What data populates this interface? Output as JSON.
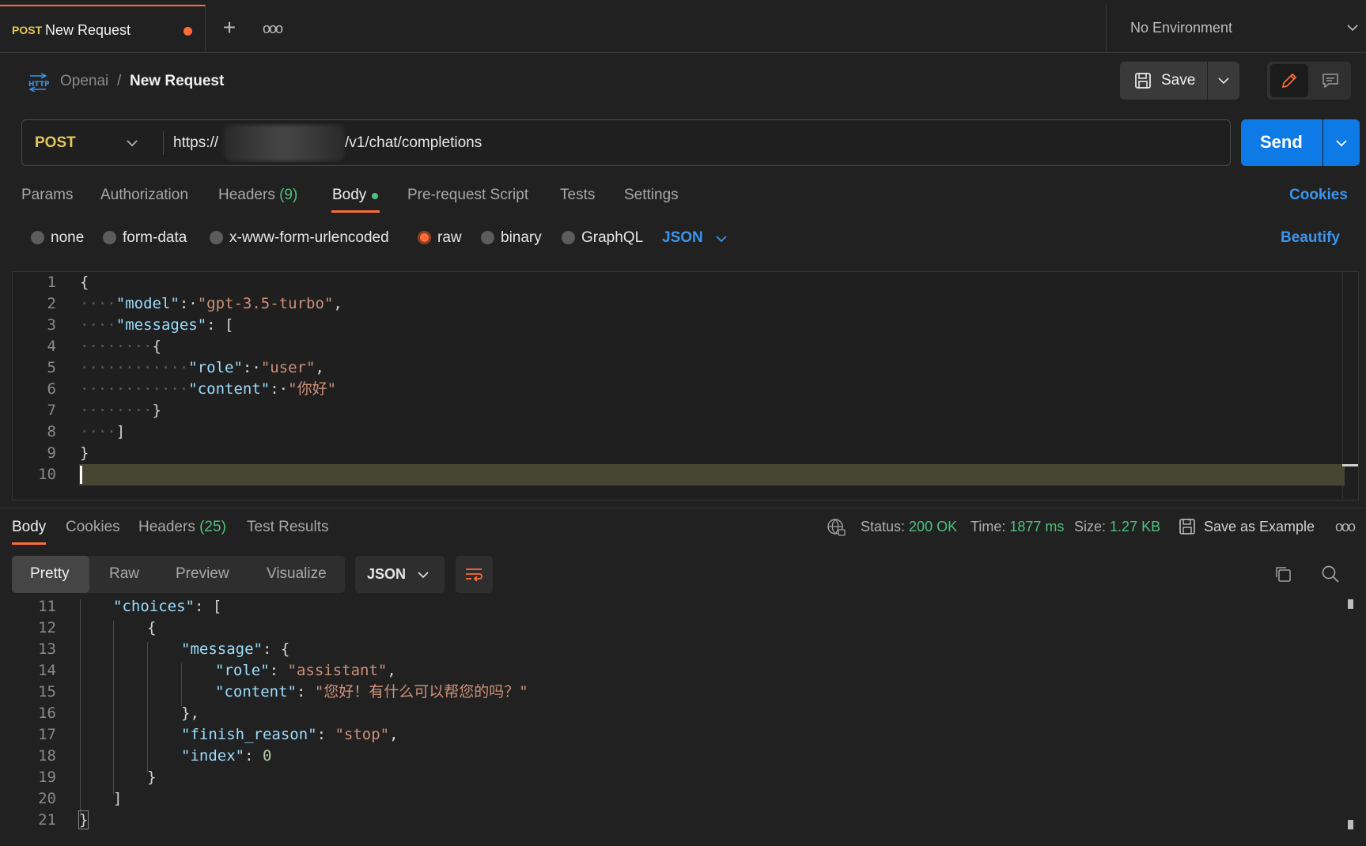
{
  "tabs": {
    "active": {
      "method": "POST",
      "title": "New Request"
    },
    "more": "ooo"
  },
  "environment": {
    "label": "No Environment"
  },
  "breadcrumb": {
    "parent": "Openai",
    "separator": "/",
    "current": "New Request"
  },
  "toolbar": {
    "save_label": "Save"
  },
  "request": {
    "method": "POST",
    "url_prefix": "https://",
    "url_suffix": "/v1/chat/completions",
    "send_label": "Send"
  },
  "request_tabs": {
    "params": "Params",
    "authorization": "Authorization",
    "headers": "Headers",
    "headers_count": "(9)",
    "body": "Body",
    "prerequest": "Pre-request Script",
    "tests": "Tests",
    "settings": "Settings",
    "cookies": "Cookies"
  },
  "body_types": {
    "none": "none",
    "form_data": "form-data",
    "urlencoded": "x-www-form-urlencoded",
    "raw": "raw",
    "binary": "binary",
    "graphql": "GraphQL",
    "language": "JSON",
    "beautify": "Beautify"
  },
  "request_body_lines": [
    {
      "n": "1",
      "text": "{"
    },
    {
      "n": "2",
      "key": "\"model\"",
      "value": "\"gpt-3.5-turbo\"",
      "tail": ","
    },
    {
      "n": "3",
      "key": "\"messages\"",
      "tail": " ["
    },
    {
      "n": "4",
      "text": "{"
    },
    {
      "n": "5",
      "key": "\"role\"",
      "value": "\"user\"",
      "tail": ","
    },
    {
      "n": "6",
      "key": "\"content\"",
      "value": "\"你好\""
    },
    {
      "n": "7",
      "text": "}"
    },
    {
      "n": "8",
      "text": "]"
    },
    {
      "n": "9",
      "text": "}"
    },
    {
      "n": "10",
      "text": ""
    }
  ],
  "response_tabs": {
    "body": "Body",
    "cookies": "Cookies",
    "headers": "Headers",
    "headers_count": "(25)",
    "test_results": "Test Results"
  },
  "response_meta": {
    "status_label": "Status:",
    "status_value": "200 OK",
    "time_label": "Time:",
    "time_value": "1877 ms",
    "size_label": "Size:",
    "size_value": "1.27 KB",
    "save_example": "Save as Example",
    "more": "ooo"
  },
  "view_tabs": {
    "pretty": "Pretty",
    "raw": "Raw",
    "preview": "Preview",
    "visualize": "Visualize",
    "language": "JSON"
  },
  "response_body_lines": [
    {
      "n": "11",
      "key": "\"choices\"",
      "tail": ": ["
    },
    {
      "n": "12",
      "text": "{"
    },
    {
      "n": "13",
      "key": "\"message\"",
      "tail": ": {"
    },
    {
      "n": "14",
      "key": "\"role\"",
      "value": "\"assistant\"",
      "tail": ","
    },
    {
      "n": "15",
      "key": "\"content\"",
      "value": "\"您好！有什么可以帮您的吗？\""
    },
    {
      "n": "16",
      "text": "},"
    },
    {
      "n": "17",
      "key": "\"finish_reason\"",
      "value": "\"stop\"",
      "tail": ","
    },
    {
      "n": "18",
      "key": "\"index\"",
      "number": "0"
    },
    {
      "n": "19",
      "text": "}"
    },
    {
      "n": "20",
      "text": "]"
    },
    {
      "n": "21",
      "text": "}"
    }
  ],
  "colors": {
    "accent": "#ff6c37",
    "primary": "#0d7ae6",
    "method": "#e6c65c",
    "success": "#4ec27c"
  }
}
